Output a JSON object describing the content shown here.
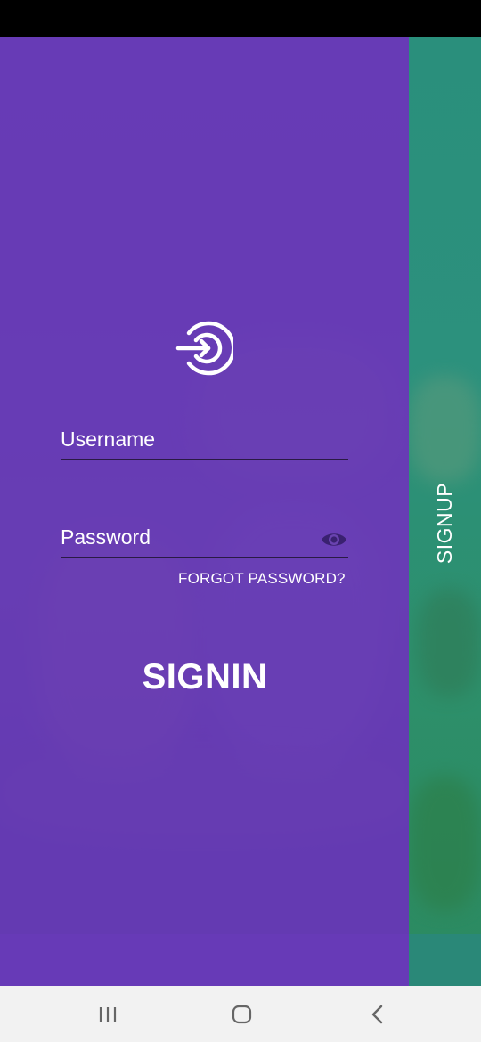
{
  "login": {
    "username_placeholder": "Username",
    "password_placeholder": "Password",
    "forgot_password": "FORGOT PASSWORD?",
    "signin_label": "SIGNIN"
  },
  "signup": {
    "label": "SIGNUP"
  },
  "icons": {
    "logo": "login-arrow-icon",
    "password_toggle": "eye-icon",
    "nav_recents": "recent-apps-icon",
    "nav_home": "home-icon",
    "nav_back": "back-icon"
  },
  "colors": {
    "signin_panel": "#673ab7",
    "signup_panel": "#2a8f7c",
    "status_bar": "#000000",
    "nav_bar": "#f2f2f2",
    "text": "#ffffff",
    "input_underline": "#2a1a44",
    "eye_icon": "#3a2170"
  }
}
